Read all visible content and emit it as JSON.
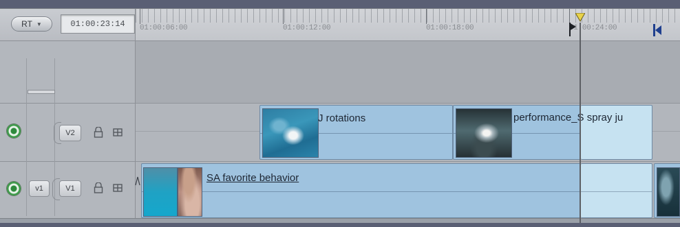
{
  "header": {
    "rt_label": "RT",
    "timecode": "01:00:23:14"
  },
  "ruler": {
    "labels": [
      "01:00:06:00",
      "01:00:12:00",
      "01:00:18:00",
      "01:00:24:00"
    ]
  },
  "tracks": {
    "v2": {
      "source_label": "V2"
    },
    "v1": {
      "source_label": "v1",
      "dest_label": "V1"
    }
  },
  "clips": {
    "rotations": "J rotations",
    "performance": "performance_S spray ju",
    "favorite": "SA favorite behavior"
  },
  "colors": {
    "clip_fill": "#9fc3df",
    "clip_selected_fill": "#c6e2f1",
    "track_bg": "#b2b6bc",
    "visibility_green": "#2e8a3c"
  }
}
